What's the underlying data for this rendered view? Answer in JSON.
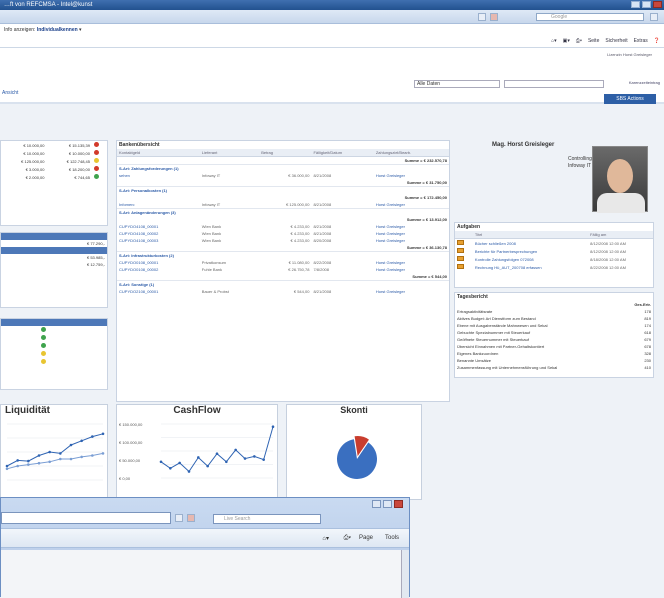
{
  "window": {
    "title": "…ft von REFCMSA - Intel@kunst"
  },
  "search": {
    "placeholder": "Google"
  },
  "menu": {
    "prefix": "Info anzeigen:",
    "selection": "Individualkennen"
  },
  "commands": [
    "Seite",
    "Sicherheit",
    "Extras"
  ],
  "header_right": "Lizenzin Horst Greisleger",
  "filter": {
    "select": "Alle Daten",
    "checkbox": "Karenzzeiteintrag"
  },
  "ribbon_button": "SBS Actions",
  "view_link": "Ansicht",
  "kpi": {
    "rows": [
      {
        "a": "€ 10.000,00",
        "b": "€ 15.135,39",
        "c": "#d23a2b"
      },
      {
        "a": "€ 10.000,00",
        "b": "€ 10.000,00",
        "c": "#d23a2b"
      },
      {
        "a": "€ 125.000,00",
        "b": "€ 122.748,45",
        "c": "#e8c531"
      },
      {
        "a": "€ 3.000,00",
        "b": "€ 18.200,00",
        "c": "#d23a2b"
      },
      {
        "a": "€ 2.000,00",
        "b": "€ 744,65",
        "c": "#3fa34d"
      }
    ]
  },
  "side_values": {
    "v1": "€ 77.290,-",
    "v2": "€ 53.985,-",
    "v3": "€ 12.759,-"
  },
  "bank": {
    "title": "Bankenübersicht",
    "cols": [
      "Kontaktgeld",
      "Lieferant",
      "Betrag",
      "Fälligkeit/Datum",
      "Zahlungsziel/Bearb."
    ],
    "groups": [
      {
        "sum": "Summe = € 232.570,78",
        "label": "S-Art: Zahlungsforderungen (1)",
        "rows": [
          [
            "sehen",
            "Infoway IT",
            "€ 36.000,00",
            "8/21/2008",
            "Horst Greisleger"
          ]
        ]
      },
      {
        "sum": "Summe = € 31.750,00",
        "label": "S-Art: Personalkosten (1)",
        "rows": []
      },
      {
        "sum": "Summe = € 172.450,00",
        "label": "",
        "rows": [
          [
            "Infomerc",
            "Infoway IT",
            "€ 125.000,00",
            "8/21/2008",
            "Horst Greisleger"
          ]
        ]
      },
      {
        "sum": "",
        "label": "S-Art: Anlagenänderungen (3)",
        "rows": []
      },
      {
        "sum": "Summe = € 13.912,00",
        "label": "",
        "rows": [
          [
            "CUPYDO4108_00001",
            "Wien Bank",
            "€ 4.233,00",
            "8/21/2008",
            "Horst Greisleger"
          ],
          [
            "CUPYDO4108_00002",
            "Wien Bank",
            "€ 4.233,00",
            "8/21/2008",
            "Horst Greisleger"
          ],
          [
            "CUPYDO4108_00003",
            "Wien Bank",
            "€ 4.233,00",
            "8/20/2008",
            "Horst Greisleger"
          ]
        ]
      },
      {
        "sum": "Summe = € 36.130,78",
        "label": "S-Art: Infrastrukturkosten (2)",
        "rows": [
          [
            "CUPYDO0108_00001",
            "Privatkonsum",
            "€ 11.080,00",
            "8/22/2008",
            "Horst Greisleger"
          ],
          [
            "CUPYDO0108_00002",
            "Fuhle Bank",
            "€ 26.750,78",
            "7/8/2008",
            "Horst Greisleger"
          ]
        ]
      },
      {
        "sum": "Summe = € 544,00",
        "label": "S-Art: Sonstige (1)",
        "rows": [
          [
            "CUPYDO2108_00001",
            "Bauer & Probst",
            "€ 544,00",
            "8/21/2008",
            "Horst Greisleger"
          ]
        ]
      }
    ]
  },
  "profile": {
    "name": "Mag. Horst Greisleger",
    "role1": "Controlling",
    "role2": "Infoway IT"
  },
  "tasks": {
    "title": "Aufgaben",
    "cols": [
      "Titel",
      "Fällig am"
    ],
    "items": [
      {
        "t": "Bücher schließen 2008",
        "d": "8/12/2008 12:00 AM"
      },
      {
        "t": "Berichte für Partnerbesprechungen",
        "d": "8/12/2008 12:00 AM"
      },
      {
        "t": "Kontrolle Zahlungsfolgen 072008",
        "d": "8/18/2008 12:00 AM"
      },
      {
        "t": "Rechnung Hü_AUT_200708 erfassen",
        "d": "8/22/2008 12:00 AM"
      }
    ]
  },
  "metrics": {
    "title": "Tagesbericht",
    "col": "Ges.Ertr.",
    "rows": [
      {
        "l": "Ertragsaktivitätsrate",
        "v": "178"
      },
      {
        "l": "Aktives Budget: Art Dienstform zum Bestand",
        "v": "819"
      },
      {
        "l": "Ebene mit Ausgabenstände Mahnwesen und Sekal",
        "v": "174"
      },
      {
        "l": "Gebuchte Spezialnummer mit Steuerkauf",
        "v": "618"
      },
      {
        "l": "Geöffnete Steuernummer mit Steuerkauf",
        "v": "679"
      },
      {
        "l": "Übersicht Einnahmen mit Partner-Gehaltskontiert",
        "v": "678"
      },
      {
        "l": "Eigenes Bankzuordnen",
        "v": "328"
      },
      {
        "l": "Benannte Umsätze",
        "v": "230"
      },
      {
        "l": "Zusammenfassung mit Unternehmensführung und Sekal",
        "v": "410"
      }
    ]
  },
  "charts": [
    {
      "title": "Liquidität",
      "ylabels": []
    },
    {
      "title": "CashFlow",
      "ylabels": [
        "€ 150.000,00",
        "€ 100.000,00",
        "€ 50.000,00",
        "€ 0,00"
      ]
    },
    {
      "title": "Skonti",
      "ylabels": []
    }
  ],
  "chart_data": [
    {
      "type": "line",
      "title": "Liquidität",
      "x": [
        1,
        2,
        3,
        4,
        5,
        6,
        7,
        8,
        9,
        10
      ],
      "series": [
        {
          "values": [
            20,
            28,
            27,
            35,
            40,
            38,
            50,
            56,
            62,
            66
          ]
        },
        {
          "values": [
            16,
            20,
            22,
            24,
            26,
            30,
            30,
            33,
            35,
            38
          ]
        }
      ]
    },
    {
      "type": "line",
      "title": "CashFlow",
      "x": [
        1,
        2,
        3,
        4,
        5,
        6,
        7,
        8,
        9,
        10,
        11,
        12,
        13
      ],
      "yticklabels": [
        "€ 150.000,00",
        "€ 100.000,00",
        "€ 50.000,00",
        "€ 0,00"
      ],
      "series": [
        {
          "values": [
            30,
            18,
            28,
            12,
            38,
            22,
            45,
            30,
            52,
            36,
            40,
            34,
            95
          ]
        }
      ]
    },
    {
      "type": "pie",
      "title": "Skonti",
      "values": [
        88,
        12
      ],
      "colors": [
        "#3a6fc0",
        "#c93d2e"
      ]
    }
  ],
  "popup": {
    "search_placeholder": "Live Search",
    "cmds": [
      "Page",
      "Tools"
    ]
  }
}
